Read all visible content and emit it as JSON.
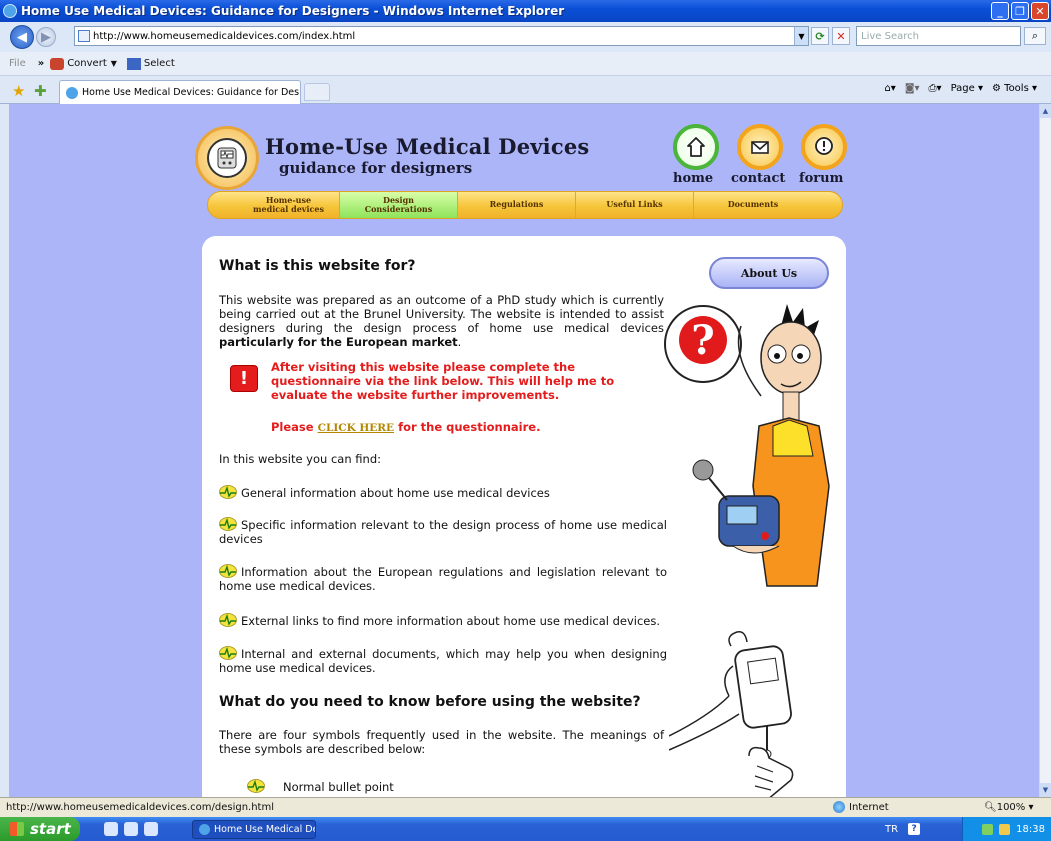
{
  "window": {
    "title": "Home Use Medical Devices: Guidance for Designers - Windows Internet Explorer"
  },
  "toolbar": {
    "address": "http://www.homeusemedicaldevices.com/index.html",
    "search_placeholder": "Live Search",
    "file_label": "File",
    "convert_label": "Convert",
    "select_label": "Select",
    "page_label": "Page",
    "tools_label": "Tools"
  },
  "tab": {
    "label": "Home Use Medical Devices: Guidance for Designers"
  },
  "site": {
    "title": "Home-Use Medical Devices",
    "subtitle": "guidance for designers",
    "header_buttons": [
      "home",
      "contact",
      "forum"
    ],
    "nav": [
      {
        "line1": "Home-use",
        "line2": "medical devices"
      },
      {
        "line1": "Design",
        "line2": "Considerations"
      },
      {
        "line1": "Regulations",
        "line2": ""
      },
      {
        "line1": "Useful Links",
        "line2": ""
      },
      {
        "line1": "Documents",
        "line2": ""
      }
    ],
    "active_nav": "Design Considerations",
    "about_button": "About Us"
  },
  "content": {
    "heading1": "What is this website for?",
    "intro_part1": "This website was prepared as an outcome of a PhD study which is currently being carried out at the Brunel University. The website is intended to assist designers during the design process of home use medical devices",
    "intro_bold": "particularly for the European market",
    "intro_end": ".",
    "warning": "After visiting this website please complete the questionnaire via the link below. This will help me to evaluate the website further improvements.",
    "please_prefix": "Please",
    "click_here": "CLICK HERE",
    "please_suffix": "for the questionnaire.",
    "find_intro": "In this website you can find:",
    "bullets": [
      "General information about home use medical devices",
      "Specific information relevant to the design process of home use medical devices",
      "Information about the European regulations and legislation relevant to home use medical devices.",
      "External links to find more information about home use medical devices.",
      "Internal and external documents, which may help you when designing home use medical devices."
    ],
    "heading2": "What do you need to know before using the website?",
    "symbols_intro": "There are four symbols frequently used in the website. The meanings of these symbols are described below:",
    "symbol1": "Normal bullet point"
  },
  "status": {
    "url": "http://www.homeusemedicaldevices.com/design.html",
    "zone": "Internet",
    "zoom": "100%"
  },
  "taskbar": {
    "start": "start",
    "task": "Home Use Medical De...",
    "lang": "TR",
    "time": "18:38"
  },
  "colors": {
    "page_bg": "#abb5f8",
    "nav_gold": "#f6c53a",
    "nav_active": "#8ee35a",
    "warning_red": "#e41c1c"
  }
}
